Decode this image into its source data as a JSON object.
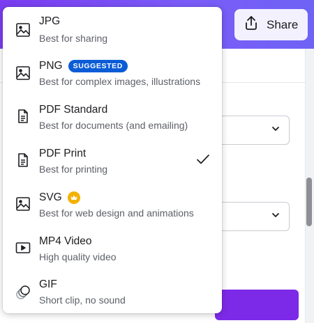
{
  "header": {
    "share_label": "Share"
  },
  "menu": {
    "items": [
      {
        "title": "JPG",
        "subtitle": "Best for sharing",
        "icon": "image-icon"
      },
      {
        "title": "PNG",
        "badge": "SUGGESTED",
        "subtitle": "Best for complex images, illustrations",
        "icon": "image-icon"
      },
      {
        "title": "PDF Standard",
        "subtitle": "Best for documents (and emailing)",
        "icon": "document-icon"
      },
      {
        "title": "PDF Print",
        "subtitle": "Best for printing",
        "icon": "document-icon",
        "selected": true
      },
      {
        "title": "SVG",
        "subtitle": "Best for web design and animations",
        "icon": "image-icon",
        "premium": true
      },
      {
        "title": "MP4 Video",
        "subtitle": "High quality video",
        "icon": "video-icon"
      },
      {
        "title": "GIF",
        "subtitle": "Short clip, no sound",
        "icon": "gif-icon"
      }
    ]
  },
  "colors": {
    "brand": "#7d2ae8",
    "badge": "#0b5cd6",
    "crown": "#f4b100"
  }
}
